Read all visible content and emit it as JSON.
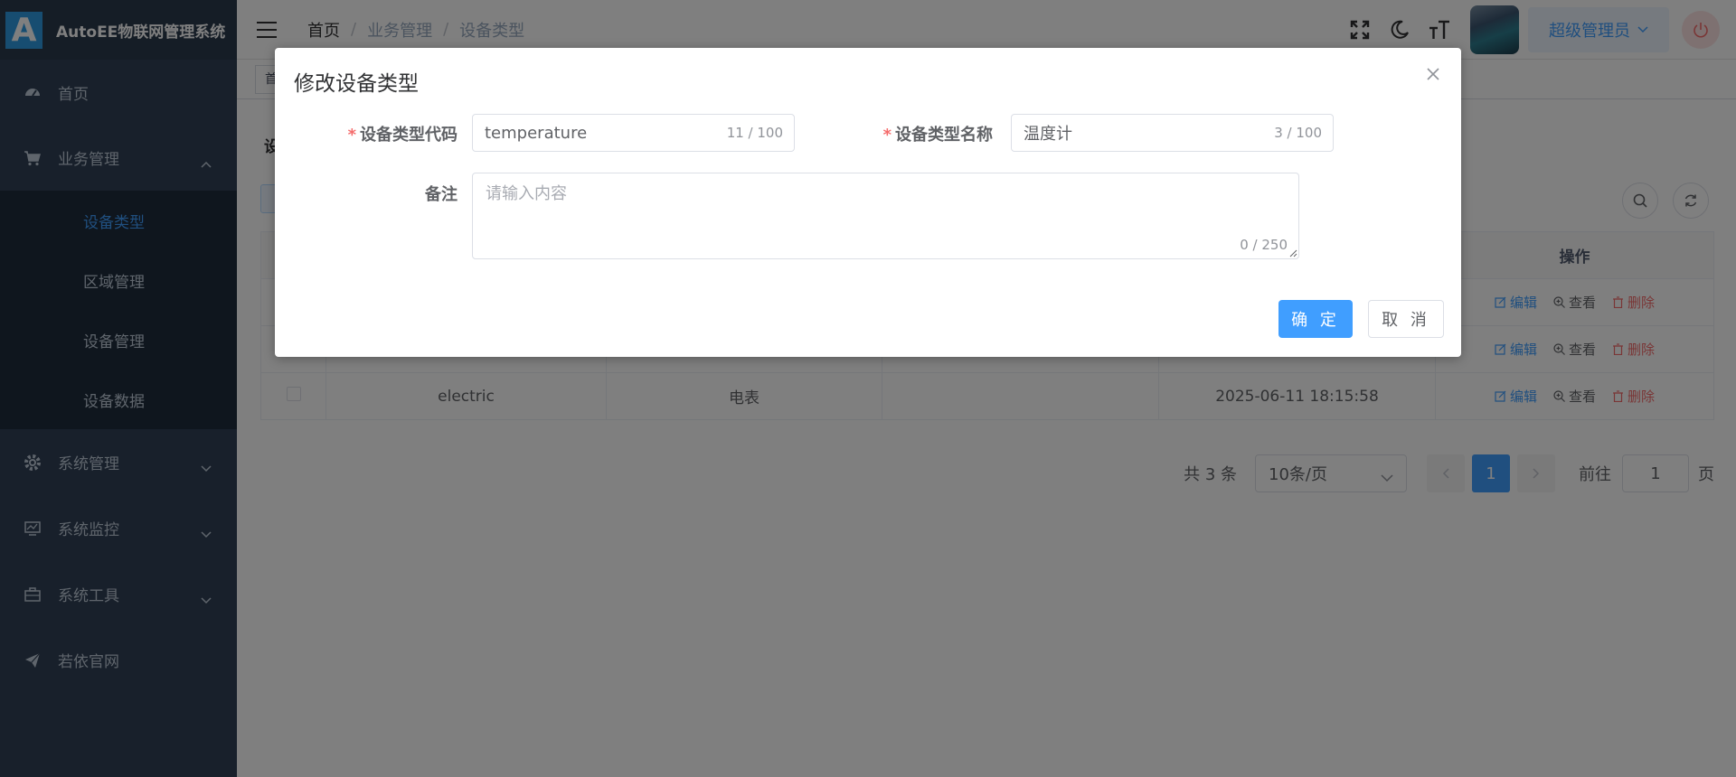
{
  "app": {
    "logo_letter": "A",
    "title": "AutoEE物联网管理系统"
  },
  "sidebar": {
    "items": [
      {
        "label": "首页",
        "icon": "dashboard-icon"
      },
      {
        "label": "业务管理",
        "icon": "cart-icon",
        "expanded": true,
        "children": [
          {
            "label": "设备类型",
            "active": true
          },
          {
            "label": "区域管理"
          },
          {
            "label": "设备管理"
          },
          {
            "label": "设备数据"
          }
        ]
      },
      {
        "label": "系统管理",
        "icon": "gear-icon"
      },
      {
        "label": "系统监控",
        "icon": "monitor-icon"
      },
      {
        "label": "系统工具",
        "icon": "toolbox-icon"
      },
      {
        "label": "若依官网",
        "icon": "send-icon"
      }
    ]
  },
  "header": {
    "breadcrumb": [
      "首页",
      "业务管理",
      "设备类型"
    ],
    "separator": "/",
    "user_name": "超级管理员"
  },
  "tags": {
    "first": "首"
  },
  "main": {
    "search_label": "设",
    "table": {
      "headers": [
        "",
        "",
        "",
        "",
        "",
        "操作"
      ],
      "rows": [
        {
          "code": "",
          "name": "",
          "remark": "",
          "time": ""
        },
        {
          "code": "",
          "name": "",
          "remark": "",
          "time": ""
        },
        {
          "code": "electric",
          "name": "电表",
          "remark": "",
          "time": "2025-06-11 18:15:58"
        }
      ],
      "actions": {
        "edit": "编辑",
        "view": "查看",
        "delete": "删除"
      }
    },
    "pagination": {
      "total": "共 3 条",
      "page_size": "10条/页",
      "current_page": "1",
      "goto_label": "前往",
      "goto_value": "1",
      "page_suffix": "页"
    }
  },
  "dialog": {
    "title": "修改设备类型",
    "required_mark": "*",
    "code_label": "设备类型代码",
    "code_value": "temperature",
    "code_count": "11 / 100",
    "name_label": "设备类型名称",
    "name_value": "温度计",
    "name_count": "3 / 100",
    "remark_label": "备注",
    "remark_placeholder": "请输入内容",
    "remark_count": "0 / 250",
    "confirm": "确 定",
    "cancel": "取 消"
  },
  "colors": {
    "primary": "#409eff",
    "sidebar_bg": "#304156",
    "danger": "#f56c6c"
  }
}
